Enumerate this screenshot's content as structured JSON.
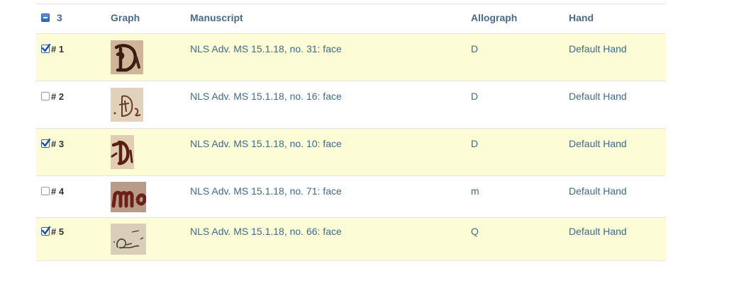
{
  "header": {
    "count": "3",
    "graph": "Graph",
    "manuscript": "Manuscript",
    "allograph": "Allograph",
    "hand": "Hand"
  },
  "rows": [
    {
      "number": "# 1",
      "checked": true,
      "manuscript": "NLS Adv. MS 15.1.18, no. 31: face",
      "allograph": "D",
      "hand": "Default Hand"
    },
    {
      "number": "# 2",
      "checked": false,
      "manuscript": "NLS Adv. MS 15.1.18, no. 16: face",
      "allograph": "D",
      "hand": "Default Hand"
    },
    {
      "number": "# 3",
      "checked": true,
      "manuscript": "NLS Adv. MS 15.1.18, no. 10: face",
      "allograph": "D",
      "hand": "Default Hand"
    },
    {
      "number": "# 4",
      "checked": false,
      "manuscript": "NLS Adv. MS 15.1.18, no. 71: face",
      "allograph": "m",
      "hand": "Default Hand"
    },
    {
      "number": "# 5",
      "checked": true,
      "manuscript": "NLS Adv. MS 15.1.18, no. 66: face",
      "allograph": "Q",
      "hand": "Default Hand"
    }
  ],
  "colors": {
    "selected_row": "#fcfcd7",
    "link": "#3c6b8c",
    "header_text": "#4a6a86",
    "border": "#e3e3e3"
  },
  "icons": {
    "collapse": "minus-box-icon",
    "selected": "checked-checkbox-icon",
    "unselected": "empty-checkbox-icon"
  }
}
